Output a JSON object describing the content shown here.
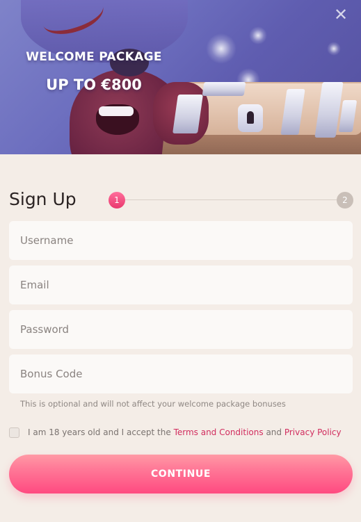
{
  "banner": {
    "title": "WELCOME PACKAGE",
    "subtitle": "UP TO €800",
    "close_icon": "close-icon",
    "close_glyph": "✕"
  },
  "form": {
    "title": "Sign Up",
    "steps": [
      {
        "label": "1",
        "state": "active"
      },
      {
        "label": "2",
        "state": "inactive"
      }
    ],
    "fields": {
      "username": {
        "placeholder": "Username",
        "value": ""
      },
      "email": {
        "placeholder": "Email",
        "value": ""
      },
      "password": {
        "placeholder": "Password",
        "value": ""
      },
      "bonus_code": {
        "placeholder": "Bonus Code",
        "value": ""
      }
    },
    "bonus_hint": "This is optional and will not affect your welcome package bonuses",
    "consent": {
      "prefix": "I am 18 years old and I accept the ",
      "terms_link": "Terms and Conditions",
      "joiner": " and ",
      "privacy_link": "Privacy Policy",
      "checked": false
    },
    "continue_label": "CONTINUE"
  },
  "colors": {
    "accent": "#e9386d",
    "button_gradient_top": "#ff9aa5",
    "button_gradient_bottom": "#ff4a80",
    "link": "#d12d5e",
    "background": "#f4ede7"
  }
}
